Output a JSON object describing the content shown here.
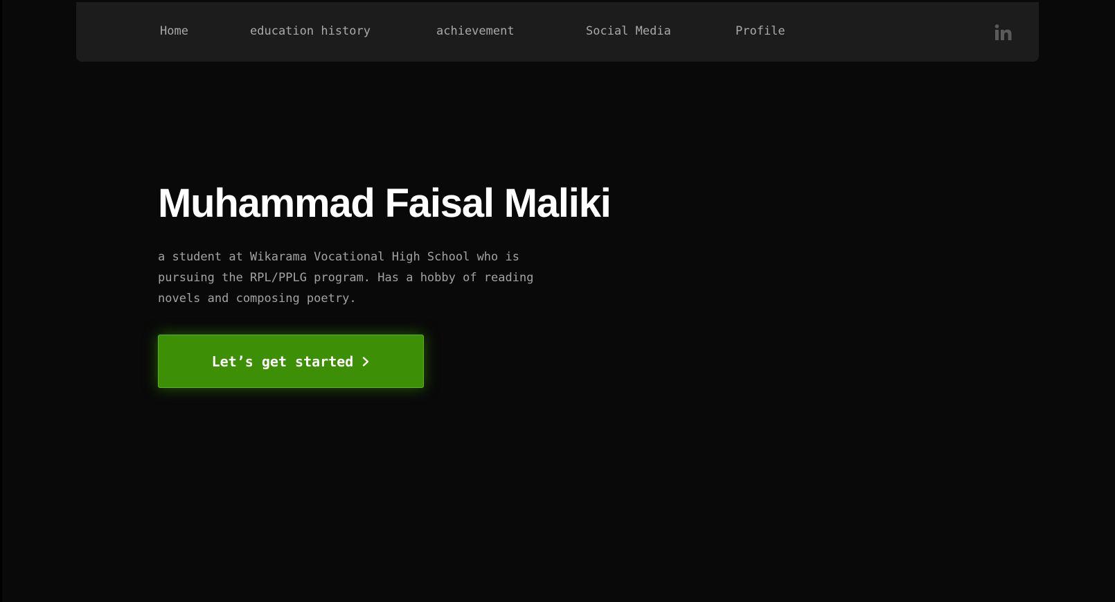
{
  "nav": {
    "links": [
      {
        "label": "Home"
      },
      {
        "label": "education history"
      },
      {
        "label": "achievement"
      },
      {
        "label": "Social Media"
      },
      {
        "label": "Profile"
      }
    ],
    "social_icon": "linkedin-icon"
  },
  "hero": {
    "title": "Muhammad Faisal Maliki",
    "description": "a student at Wikarama Vocational High School who is pursuing the RPL/PPLG program. Has a hobby of reading novels and composing poetry.",
    "cta_label": "Let’s get started",
    "cta_icon": "chevron-right-icon"
  },
  "colors": {
    "background": "#090909",
    "navbar": "#1c1c1c",
    "nav_text": "#a9a9a9",
    "title": "#ffffff",
    "body_text": "#a3a3a3",
    "accent": "#3d8f05",
    "icon": "#5a5a5a"
  }
}
